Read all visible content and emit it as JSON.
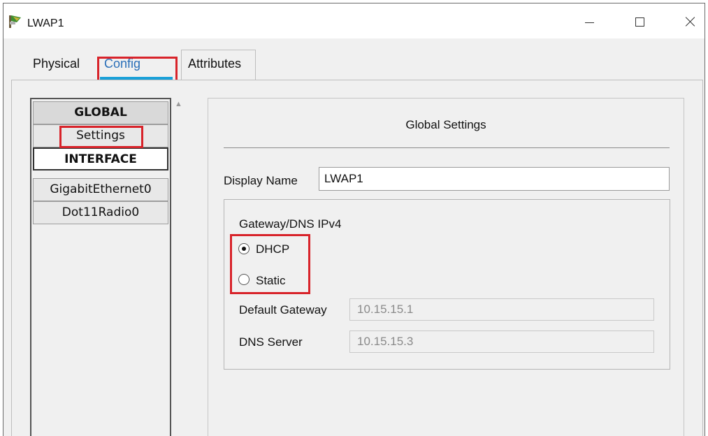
{
  "window": {
    "title": "LWAP1",
    "icon": "access-point-icon",
    "controls": [
      "minimize",
      "maximize",
      "close"
    ]
  },
  "tabs": [
    {
      "label": "Physical",
      "selected": false
    },
    {
      "label": "Config",
      "selected": true
    },
    {
      "label": "Attributes",
      "selected": false
    }
  ],
  "sidebar": {
    "items": [
      {
        "label": "GLOBAL",
        "type": "header"
      },
      {
        "label": "Settings",
        "type": "item"
      },
      {
        "label": "INTERFACE",
        "type": "header"
      },
      {
        "label": "GigabitEthernet0",
        "type": "item"
      },
      {
        "label": "Dot11Radio0",
        "type": "item"
      }
    ]
  },
  "panel": {
    "title": "Global Settings",
    "display_name_label": "Display Name",
    "display_name_value": "LWAP1",
    "gateway_section_title": "Gateway/DNS IPv4",
    "radio_dhcp": "DHCP",
    "radio_static": "Static",
    "selected_mode": "DHCP",
    "default_gateway_label": "Default Gateway",
    "default_gateway_value": "10.15.15.1",
    "dns_server_label": "DNS Server",
    "dns_server_value": "10.15.15.3"
  },
  "colors": {
    "highlight": "#d8232a",
    "tab_accent": "#1aa0d8",
    "background": "#f0f0f0"
  }
}
